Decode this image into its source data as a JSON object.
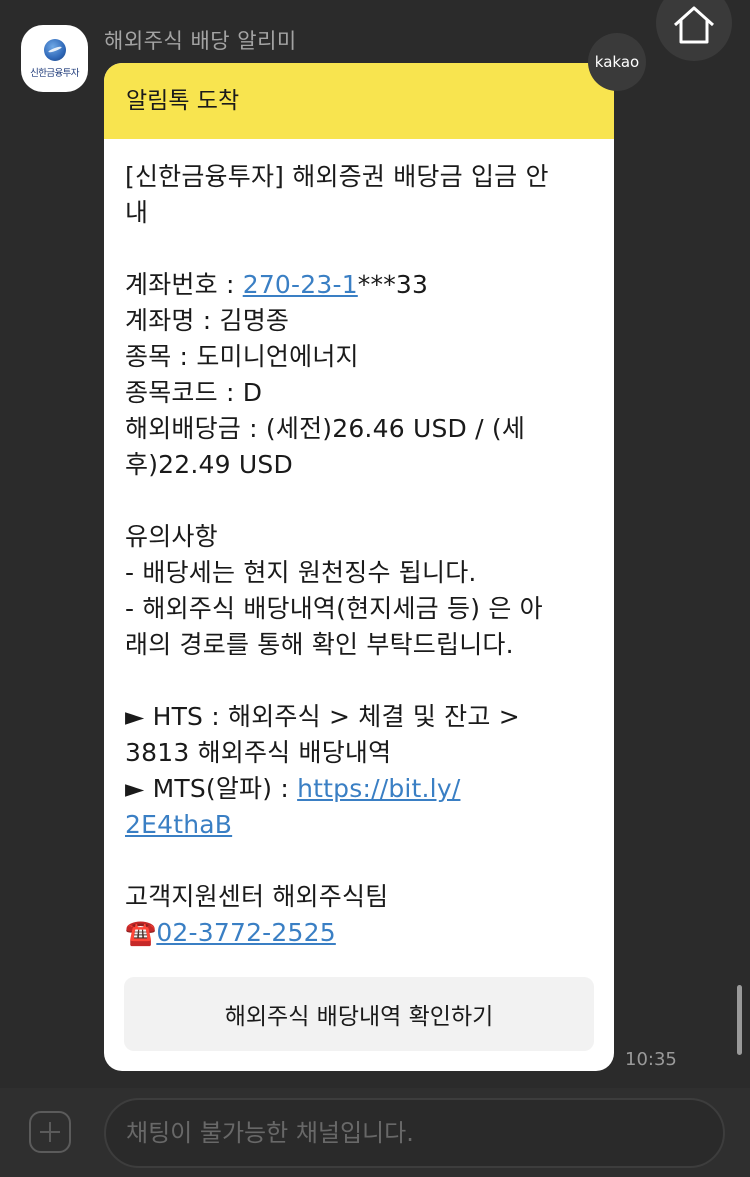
{
  "header": {
    "sender_name": "해외주식 배당 알리미",
    "avatar_brand": "신한금융투자",
    "kakao_badge": "kakao"
  },
  "message": {
    "header_title": "알림톡 도착",
    "title_line1": "[신한금융투자] 해외증권 배당금 입금 안",
    "title_line2": "내",
    "account_label": "계좌번호 : ",
    "account_link": "270-23-1",
    "account_masked": "***33",
    "account_name": "계좌명 : 김명종",
    "stock": "종목 : 도미니언에너지",
    "stock_code": "종목코드 : D",
    "dividend_line1": "해외배당금 : (세전)26.46 USD / (세",
    "dividend_line2": "후)22.49 USD",
    "notice_title": "유의사항",
    "notice_1": "- 배당세는 현지 원천징수 됩니다.",
    "notice_2_line1": "- 해외주식 배당내역(현지세금 등) 은 아",
    "notice_2_line2": "래의 경로를 통해 확인 부탁드립니다.",
    "hts_line1": "► HTS : 해외주식 > 체결 및 잔고 >",
    "hts_line2": "3813 해외주식 배당내역",
    "mts_label": "► MTS(알파) : ",
    "mts_link_1": "https://bit.ly/",
    "mts_link_2": "2E4thaB",
    "support_team": "고객지원센터 해외주식팀",
    "phone_icon": "☎️",
    "phone_number": "02-3772-2525",
    "button_label": "해외주식 배당내역 확인하기",
    "time": "10:35"
  },
  "input": {
    "placeholder": "채팅이 불가능한 채널입니다."
  }
}
